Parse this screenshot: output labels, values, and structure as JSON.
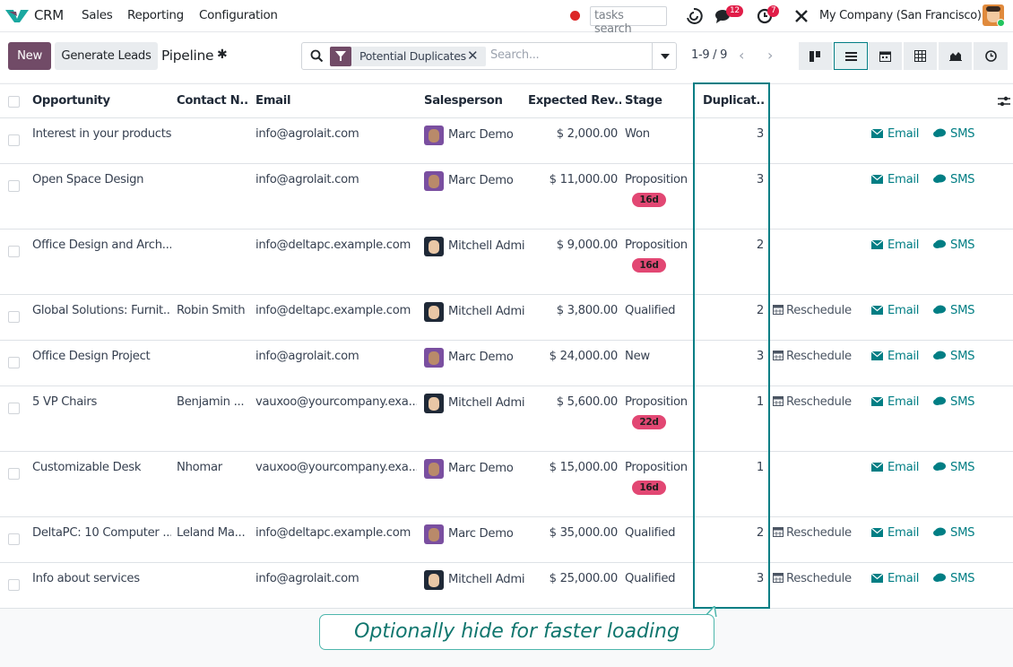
{
  "navbar": {
    "app_name": "CRM",
    "menu": [
      "Sales",
      "Reporting",
      "Configuration"
    ],
    "tasks_search": "tasks search",
    "messages_count": "12",
    "activities_count": "7",
    "company": "My Company (San Francisco)"
  },
  "control_panel": {
    "new_label": "New",
    "generate_leads_label": "Generate Leads",
    "breadcrumb": "Pipeline",
    "filter_facet": "Potential Duplicates",
    "search_placeholder": "Search...",
    "pager": "1-9 / 9"
  },
  "table": {
    "columns": [
      "Opportunity",
      "Contact N...",
      "Email",
      "Salesperson",
      "Expected Rev...",
      "Stage",
      "Duplicat..."
    ],
    "email_action": "Email",
    "sms_action": "SMS",
    "reschedule_action": "Reschedule",
    "rows": [
      {
        "opportunity": "Interest in your products",
        "contact": "",
        "email": "info@agrolait.com",
        "salesperson": "Marc Demo",
        "revenue": "$ 2,000.00",
        "stage": "Won",
        "tag": "",
        "duplicates": "3",
        "reschedule": false
      },
      {
        "opportunity": "Open Space Design",
        "contact": "",
        "email": "info@agrolait.com",
        "salesperson": "Marc Demo",
        "revenue": "$ 11,000.00",
        "stage": "Proposition",
        "tag": "16d",
        "duplicates": "3",
        "reschedule": false
      },
      {
        "opportunity": "Office Design and Arch...",
        "contact": "",
        "email": "info@deltapc.example.com",
        "salesperson": "Mitchell Admi",
        "revenue": "$ 9,000.00",
        "stage": "Proposition",
        "tag": "16d",
        "duplicates": "2",
        "reschedule": false
      },
      {
        "opportunity": "Global Solutions: Furnit...",
        "contact": "Robin Smith",
        "email": "info@deltapc.example.com",
        "salesperson": "Mitchell Admi",
        "revenue": "$ 3,800.00",
        "stage": "Qualified",
        "tag": "",
        "duplicates": "2",
        "reschedule": true
      },
      {
        "opportunity": "Office Design Project",
        "contact": "",
        "email": "info@agrolait.com",
        "salesperson": "Marc Demo",
        "revenue": "$ 24,000.00",
        "stage": "New",
        "tag": "",
        "duplicates": "3",
        "reschedule": true
      },
      {
        "opportunity": "5 VP Chairs",
        "contact": "Benjamin ...",
        "email": "vauxoo@yourcompany.exa...",
        "salesperson": "Mitchell Admi",
        "revenue": "$ 5,600.00",
        "stage": "Proposition",
        "tag": "22d",
        "duplicates": "1",
        "reschedule": true
      },
      {
        "opportunity": "Customizable Desk",
        "contact": "Nhomar",
        "email": "vauxoo@yourcompany.exa...",
        "salesperson": "Marc Demo",
        "revenue": "$ 15,000.00",
        "stage": "Proposition",
        "tag": "16d",
        "duplicates": "1",
        "reschedule": false
      },
      {
        "opportunity": "DeltaPC: 10 Computer ...",
        "contact": "Leland Ma...",
        "email": "info@deltapc.example.com",
        "salesperson": "Marc Demo",
        "revenue": "$ 35,000.00",
        "stage": "Qualified",
        "tag": "",
        "duplicates": "2",
        "reschedule": true
      },
      {
        "opportunity": "Info about services",
        "contact": "",
        "email": "info@agrolait.com",
        "salesperson": "Mitchell Admi",
        "revenue": "$ 25,000.00",
        "stage": "Qualified",
        "tag": "",
        "duplicates": "3",
        "reschedule": true
      }
    ]
  },
  "callout": "Optionally hide for faster loading",
  "colors": {
    "primary": "#714b67",
    "accent": "#017e84",
    "tag": "#e24773",
    "badge": "#e11d48"
  }
}
